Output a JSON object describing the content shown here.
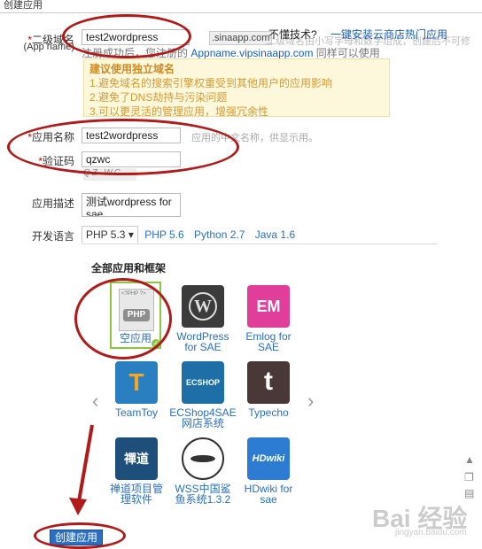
{
  "header": {
    "title": "创建应用"
  },
  "form": {
    "domain": {
      "label": "二级域名",
      "label_en": "(App name)",
      "value": "test2wordpress",
      "suffix": ".sinaapp.com",
      "hint_gray": "二级域名由小写字母和数字组成，创建后不可修改。",
      "hint_prefix": "注册成功后，您注册的",
      "hint_domain": "Appname.vipsinaapp.com",
      "hint_suffix": "同样可以使用",
      "help_q": "不懂技术?",
      "help_link": "一键安装云商店热门应用"
    },
    "tip": {
      "title": "建议使用独立域名",
      "items": [
        "1.避免域名的搜索引擎权重受到其他用户的应用影响",
        "2.避免了DNS劫持与污染问题",
        "3.可以更灵活的管理应用，增强冗余性"
      ]
    },
    "appname": {
      "label": "应用名称",
      "value": "test2wordpress",
      "hint": "应用的中文名称，供显示用。"
    },
    "captcha": {
      "label": "验证码",
      "value": "qzwc",
      "image_text": "QZ·WC"
    },
    "desc": {
      "label": "应用描述",
      "value": "测试wordpress for sae"
    },
    "lang": {
      "label": "开发语言",
      "tabs": [
        "PHP 5.3",
        "PHP 5.6",
        "Python 2.7",
        "Java 1.6"
      ],
      "active_arrow": "▾"
    }
  },
  "apps": {
    "section_title": "全部应用和框架",
    "items": [
      {
        "name": "空应用",
        "icon": "php-file-icon"
      },
      {
        "name": "WordPress for SAE",
        "icon": "wordpress-icon"
      },
      {
        "name": "Emlog for SAE",
        "icon": "emlog-icon"
      },
      {
        "name": "TeamToy",
        "icon": "teamtoy-icon"
      },
      {
        "name": "ECShop4SAE网店系统",
        "icon": "ecshop-icon"
      },
      {
        "name": "Typecho",
        "icon": "typecho-icon"
      },
      {
        "name": "禅道项目管理软件",
        "icon": "zentao-icon"
      },
      {
        "name": "WSS中国鲨鱼系统1.3.2",
        "icon": "wss-icon"
      },
      {
        "name": "HDwiki for sae",
        "icon": "hdwiki-icon"
      }
    ],
    "icon_text": {
      "php_tag": "<?PHP ?>",
      "php": "PHP",
      "wp": "W",
      "em": "EM",
      "t": "T",
      "ecs": "ECSHOP",
      "ty": "t",
      "zen": "禪道",
      "hd": "HDwiki"
    }
  },
  "submit": {
    "label": "创建应用"
  },
  "watermark": {
    "text": "Bai 经验",
    "sub": "jingyan.baidu.com"
  },
  "side_icons": [
    "arrow-up-icon",
    "copy-icon",
    "comment-icon"
  ],
  "colors": {
    "annotation_red": "#b01a1a",
    "link_blue": "#2a6fc1",
    "tip_bg": "#fdf7dc"
  }
}
